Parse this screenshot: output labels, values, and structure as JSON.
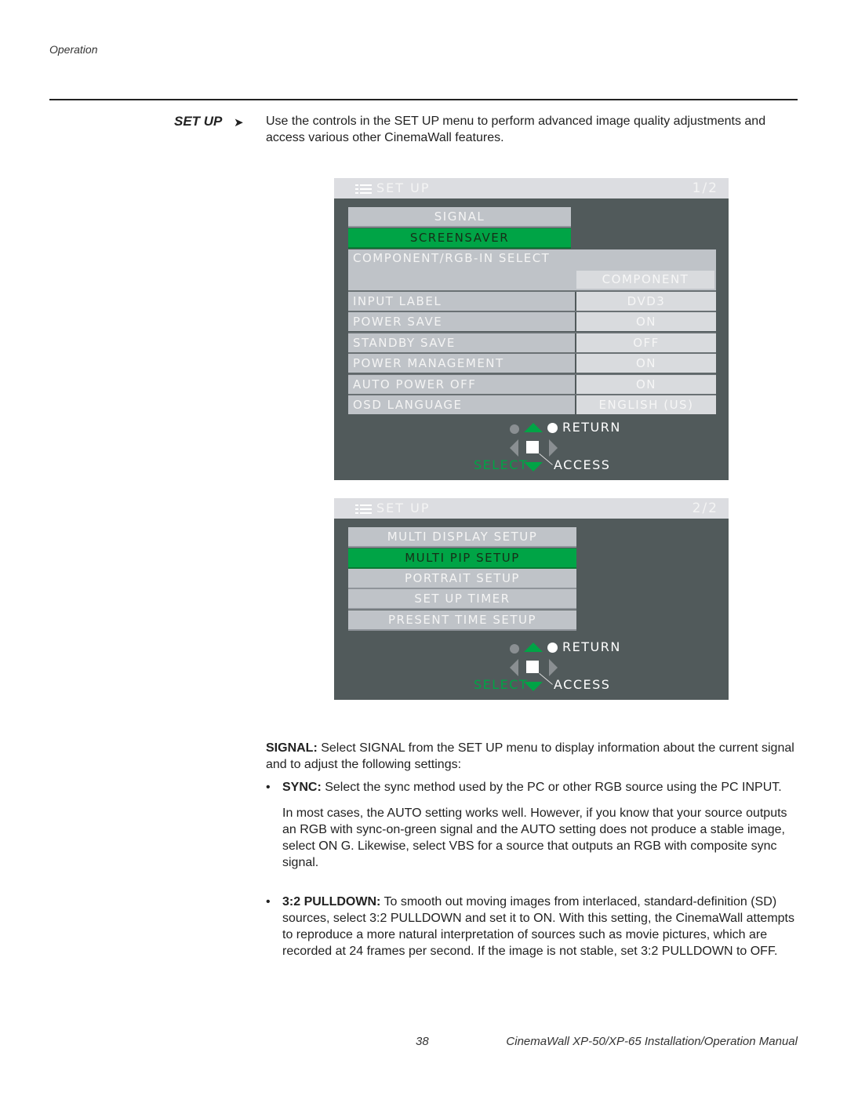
{
  "page": {
    "section": "Operation",
    "footer_page": "38",
    "footer_title": "CinemaWall XP-50/XP-65 Installation/Operation Manual"
  },
  "setup": {
    "heading": "SET UP",
    "arrow": "➤",
    "intro": "Use the controls in the SET UP menu to perform advanced image quality adjustments and access various other CinemaWall features."
  },
  "osd1": {
    "title": "SET UP",
    "page": "1/2",
    "menu_items": [
      {
        "label": "SIGNAL",
        "selected": false
      },
      {
        "label": "SCREENSAVER",
        "selected": true
      }
    ],
    "component_select": {
      "label": "COMPONENT/RGB-IN SELECT",
      "value": "COMPONENT"
    },
    "settings": [
      {
        "label": "INPUT LABEL",
        "value": "DVD3"
      },
      {
        "label": "POWER SAVE",
        "value": "ON"
      },
      {
        "label": "STANDBY SAVE",
        "value": "OFF"
      },
      {
        "label": "POWER MANAGEMENT",
        "value": "ON"
      },
      {
        "label": "AUTO POWER OFF",
        "value": "ON"
      },
      {
        "label": "OSD LANGUAGE",
        "value": "ENGLISH (US)"
      }
    ],
    "nav": {
      "return": "RETURN",
      "select": "SELECT",
      "access": "ACCESS"
    }
  },
  "osd2": {
    "title": "SET UP",
    "page": "2/2",
    "menu_items": [
      {
        "label": "MULTI DISPLAY SETUP",
        "selected": false
      },
      {
        "label": "MULTI PIP SETUP",
        "selected": true
      },
      {
        "label": "PORTRAIT SETUP",
        "selected": false
      },
      {
        "label": "SET UP TIMER",
        "selected": false
      },
      {
        "label": "PRESENT TIME SETUP",
        "selected": false
      }
    ],
    "nav": {
      "return": "RETURN",
      "select": "SELECT",
      "access": "ACCESS"
    }
  },
  "body": {
    "signal_term": "SIGNAL:",
    "signal_text": " Select SIGNAL from the SET UP menu to display information about the current signal and to adjust the following settings:",
    "bullets": [
      {
        "term": "SYNC:",
        "text": " Select the sync method used by the PC or other RGB source using the PC INPUT.",
        "extra": "In most cases, the AUTO setting works well. However, if you know that your source outputs an RGB with sync-on-green signal and the AUTO setting does not produce a stable image, select ON G. Likewise, select VBS for a source that outputs an RGB with composite sync signal."
      },
      {
        "term": "3:2 PULLDOWN:",
        "text": " To smooth out moving images from interlaced, standard-definition (SD) sources, select 3:2 PULLDOWN and set it to ON. With this setting, the CinemaWall attempts to reproduce a more natural interpretation of sources such as movie pictures, which are recorded at 24 frames per second. If the image is not stable, set 3:2 PULLDOWN to OFF."
      }
    ]
  },
  "colors": {
    "osd_bg": "#515a5b",
    "osd_title_bar": "#dcdde1",
    "menu_item": "#bfc3c8",
    "value_cell": "#d9dbde",
    "selected": "#00a446"
  }
}
